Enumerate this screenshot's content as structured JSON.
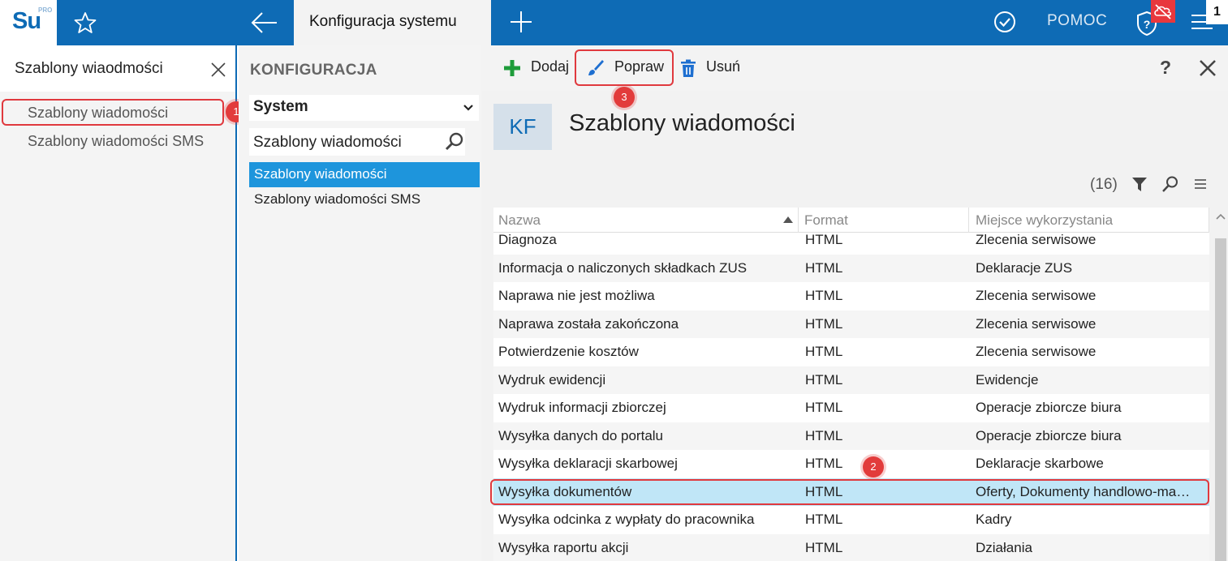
{
  "topbar": {
    "logo_text": "Su",
    "logo_super": "PRO",
    "active_tab": "Konfiguracja systemu",
    "help_label": "POMOC",
    "corner_label": "1"
  },
  "left_panel": {
    "title": "Szablony wiaodmości",
    "items": [
      {
        "label": "Szablony wiadomości"
      },
      {
        "label": "Szablony wiadomości SMS"
      }
    ]
  },
  "middle_panel": {
    "title": "KONFIGURACJA",
    "select_value": "System",
    "search_value": "Szablony wiadomości",
    "items": [
      {
        "label": "Szablony wiadomości",
        "active": true
      },
      {
        "label": "Szablony wiadomości SMS",
        "active": false
      }
    ]
  },
  "toolbar": {
    "add_label": "Dodaj",
    "edit_label": "Popraw",
    "delete_label": "Usuń",
    "help_label": "?"
  },
  "content": {
    "badge": "KF",
    "title": "Szablony wiadomości",
    "count": "(16)"
  },
  "annotations": [
    "1",
    "2",
    "3"
  ],
  "table": {
    "columns": [
      "Nazwa",
      "Format",
      "Miejsce wykorzystania"
    ],
    "rows": [
      [
        "Diagnoza",
        "HTML",
        "Zlecenia serwisowe"
      ],
      [
        "Informacja o naliczonych składkach ZUS",
        "HTML",
        "Deklaracje ZUS"
      ],
      [
        "Naprawa nie jest możliwa",
        "HTML",
        "Zlecenia serwisowe"
      ],
      [
        "Naprawa została zakończona",
        "HTML",
        "Zlecenia serwisowe"
      ],
      [
        "Potwierdzenie kosztów",
        "HTML",
        "Zlecenia serwisowe"
      ],
      [
        "Wydruk ewidencji",
        "HTML",
        "Ewidencje"
      ],
      [
        "Wydruk informacji zbiorczej",
        "HTML",
        "Operacje zbiorcze biura"
      ],
      [
        "Wysyłka danych do portalu",
        "HTML",
        "Operacje zbiorcze biura"
      ],
      [
        "Wysyłka deklaracji skarbowej",
        "HTML",
        "Deklaracje skarbowe"
      ],
      [
        "Wysyłka dokumentów",
        "HTML",
        "Oferty, Dokumenty handlowo-ma…"
      ],
      [
        "Wysyłka odcinka z wypłaty do pracownika",
        "HTML",
        "Kadry"
      ],
      [
        "Wysyłka raportu akcji",
        "HTML",
        "Działania"
      ]
    ],
    "selected_row": 9
  },
  "colors": {
    "brand": "#0e6bb5",
    "selection": "#1e95dc",
    "row_selected": "#c0e6f7",
    "annotation": "#e23b3b"
  }
}
